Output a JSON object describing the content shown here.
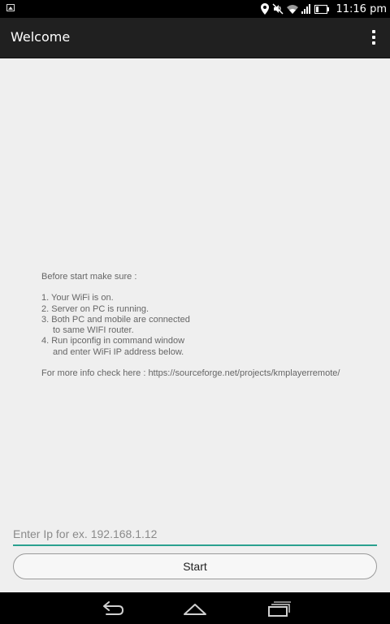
{
  "status_bar": {
    "time": "11:16 pm",
    "icons": [
      "image-notification-icon",
      "location-icon",
      "mute-icon",
      "wifi-icon",
      "signal-icon",
      "battery-icon"
    ]
  },
  "action_bar": {
    "title": "Welcome",
    "menu_icon": "overflow-menu-icon"
  },
  "instructions": {
    "heading": "Before start make sure :",
    "items": [
      "1. Your WiFi is on.",
      "2. Server on PC is running.",
      "3. Both PC and mobile are connected",
      "to same WIFI router.",
      "4. Run ipconfig in command window",
      "and enter WiFi IP address below."
    ],
    "more_info": "For more info check here : https://sourceforge.net/projects/kmplayerremote/"
  },
  "form": {
    "ip_placeholder": "Enter Ip for ex. 192.168.1.12",
    "ip_value": "",
    "start_label": "Start"
  },
  "colors": {
    "accent": "#2aa18f",
    "action_bar": "#202020",
    "background": "#efefef"
  },
  "nav_bar": {
    "icons": [
      "back-icon",
      "home-icon",
      "recent-apps-icon"
    ]
  }
}
